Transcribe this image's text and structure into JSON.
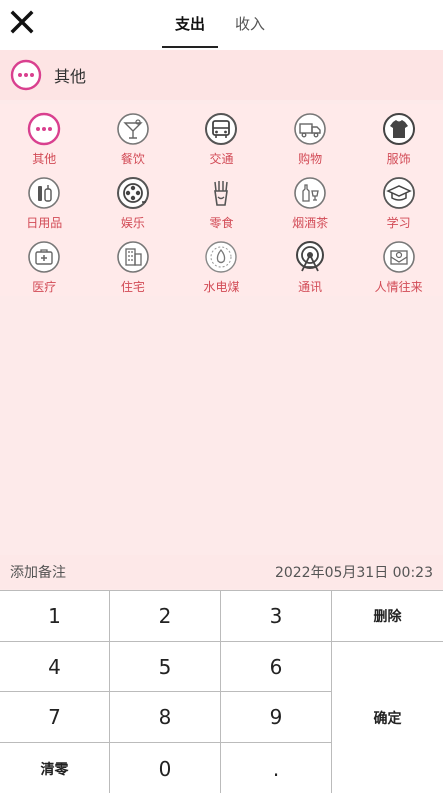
{
  "header": {
    "tabs": [
      {
        "label": "支出",
        "active": true
      },
      {
        "label": "收入",
        "active": false
      }
    ]
  },
  "selected": {
    "label": "其他",
    "icon": "more-dots-icon"
  },
  "categories": [
    {
      "label": "其他",
      "icon": "more-dots-icon"
    },
    {
      "label": "餐饮",
      "icon": "cocktail-icon"
    },
    {
      "label": "交通",
      "icon": "bus-icon"
    },
    {
      "label": "购物",
      "icon": "truck-icon"
    },
    {
      "label": "服饰",
      "icon": "tshirt-icon"
    },
    {
      "label": "日用品",
      "icon": "toiletries-icon"
    },
    {
      "label": "娱乐",
      "icon": "film-reel-icon"
    },
    {
      "label": "零食",
      "icon": "fries-icon"
    },
    {
      "label": "烟酒茶",
      "icon": "bottle-glass-icon"
    },
    {
      "label": "学习",
      "icon": "graduation-cap-icon"
    },
    {
      "label": "医疗",
      "icon": "medical-kit-icon"
    },
    {
      "label": "住宅",
      "icon": "building-icon"
    },
    {
      "label": "水电煤",
      "icon": "utility-flame-icon"
    },
    {
      "label": "通讯",
      "icon": "signal-tower-icon"
    },
    {
      "label": "人情往来",
      "icon": "envelope-gift-icon"
    }
  ],
  "note": {
    "label": "添加备注",
    "datetime": "2022年05月31日 00:23"
  },
  "keypad": {
    "k1": "1",
    "k2": "2",
    "k3": "3",
    "delete": "删除",
    "k4": "4",
    "k5": "5",
    "k6": "6",
    "k7": "7",
    "k8": "8",
    "k9": "9",
    "confirm": "确定",
    "clear": "清零",
    "k0": "0",
    "dot": "."
  },
  "colors": {
    "accent": "#d24b56",
    "background": "#fdeaea",
    "icon_gray": "#666666"
  }
}
